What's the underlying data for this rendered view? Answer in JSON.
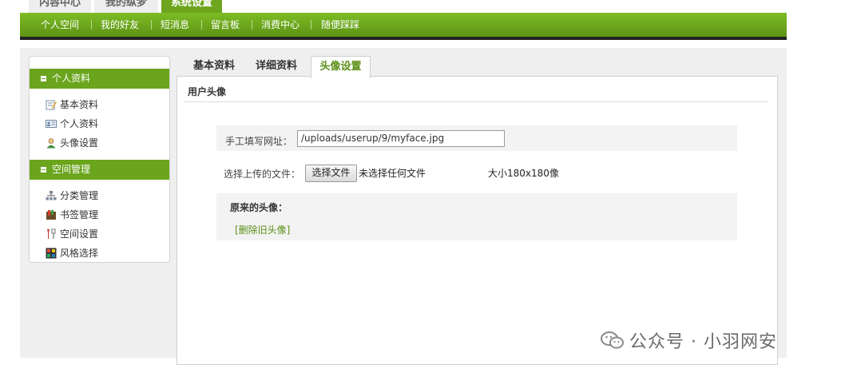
{
  "top_tabs": [
    {
      "label": "内容中心",
      "active": false
    },
    {
      "label": "我的纵梦",
      "active": false
    },
    {
      "label": "系统设置",
      "active": true
    }
  ],
  "menu": [
    "个人空间",
    "我的好友",
    "短消息",
    "留言板",
    "消费中心",
    "随便踩踩"
  ],
  "sidebar": {
    "sections": [
      {
        "title": "个人资料",
        "items": [
          {
            "label": "基本资料",
            "icon": "edit-icon"
          },
          {
            "label": "个人资料",
            "icon": "id-card-icon"
          },
          {
            "label": "头像设置",
            "icon": "user-icon"
          }
        ]
      },
      {
        "title": "空间管理",
        "items": [
          {
            "label": "分类管理",
            "icon": "org-chart-icon"
          },
          {
            "label": "书签管理",
            "icon": "bookmark-icon"
          },
          {
            "label": "空间设置",
            "icon": "tools-icon"
          },
          {
            "label": "风格选择",
            "icon": "palette-icon"
          }
        ]
      }
    ]
  },
  "content_tabs": [
    {
      "label": "基本资料",
      "active": false
    },
    {
      "label": "详细资料",
      "active": false
    },
    {
      "label": "头像设置",
      "active": true
    }
  ],
  "avatar": {
    "section_title": "用户头像",
    "url_label": "手工填写网址：",
    "url_value": "/uploads/userup/9/myface.jpg",
    "upload_label": "选择上传的文件：",
    "choose_button": "选择文件",
    "no_file_text": "未选择任何文件",
    "size_hint": "大小180x180像",
    "original_title": "原来的头像：",
    "delete_link": "[删除旧头像]"
  },
  "watermark": {
    "text": "公众号 · 小羽网安"
  },
  "colors": {
    "accent": "#6aa51d",
    "link": "#5a8f15",
    "menu_bar": "#6ea51f"
  }
}
